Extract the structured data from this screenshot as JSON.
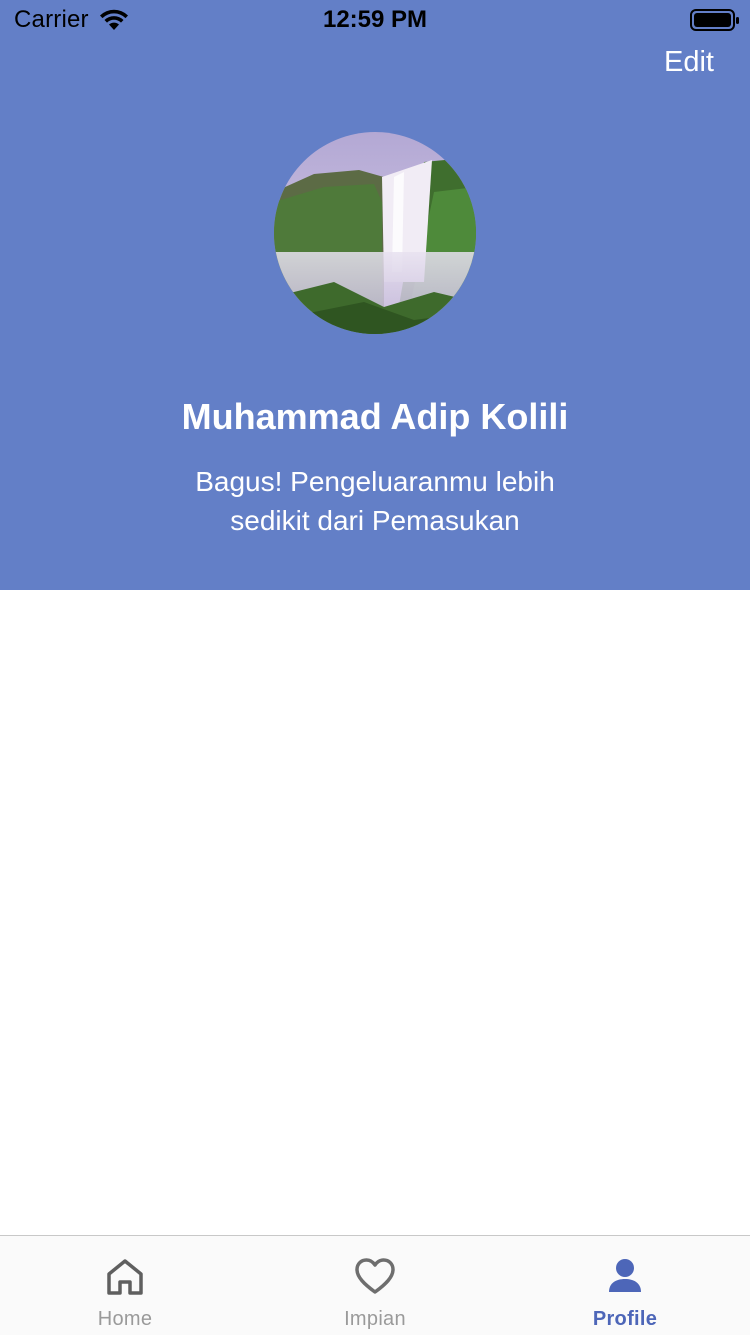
{
  "status_bar": {
    "carrier": "Carrier",
    "time": "12:59 PM",
    "icons": [
      "wifi-icon",
      "battery-icon"
    ]
  },
  "header": {
    "edit_label": "Edit",
    "background_color": "#637fc7",
    "avatar_image": "waterfall-photo"
  },
  "profile": {
    "name": "Muhammad Adip Kolili",
    "status_line_1": "Bagus! Pengeluaranmu lebih",
    "status_line_2": "sedikit dari Pemasukan"
  },
  "tab_bar": {
    "active_color": "#4d66b8",
    "inactive_color": "#9a9a9a",
    "tabs": [
      {
        "label": "Home",
        "icon": "home-icon",
        "active": false
      },
      {
        "label": "Impian",
        "icon": "heart-icon",
        "active": false
      },
      {
        "label": "Profile",
        "icon": "person-icon",
        "active": true
      }
    ]
  }
}
